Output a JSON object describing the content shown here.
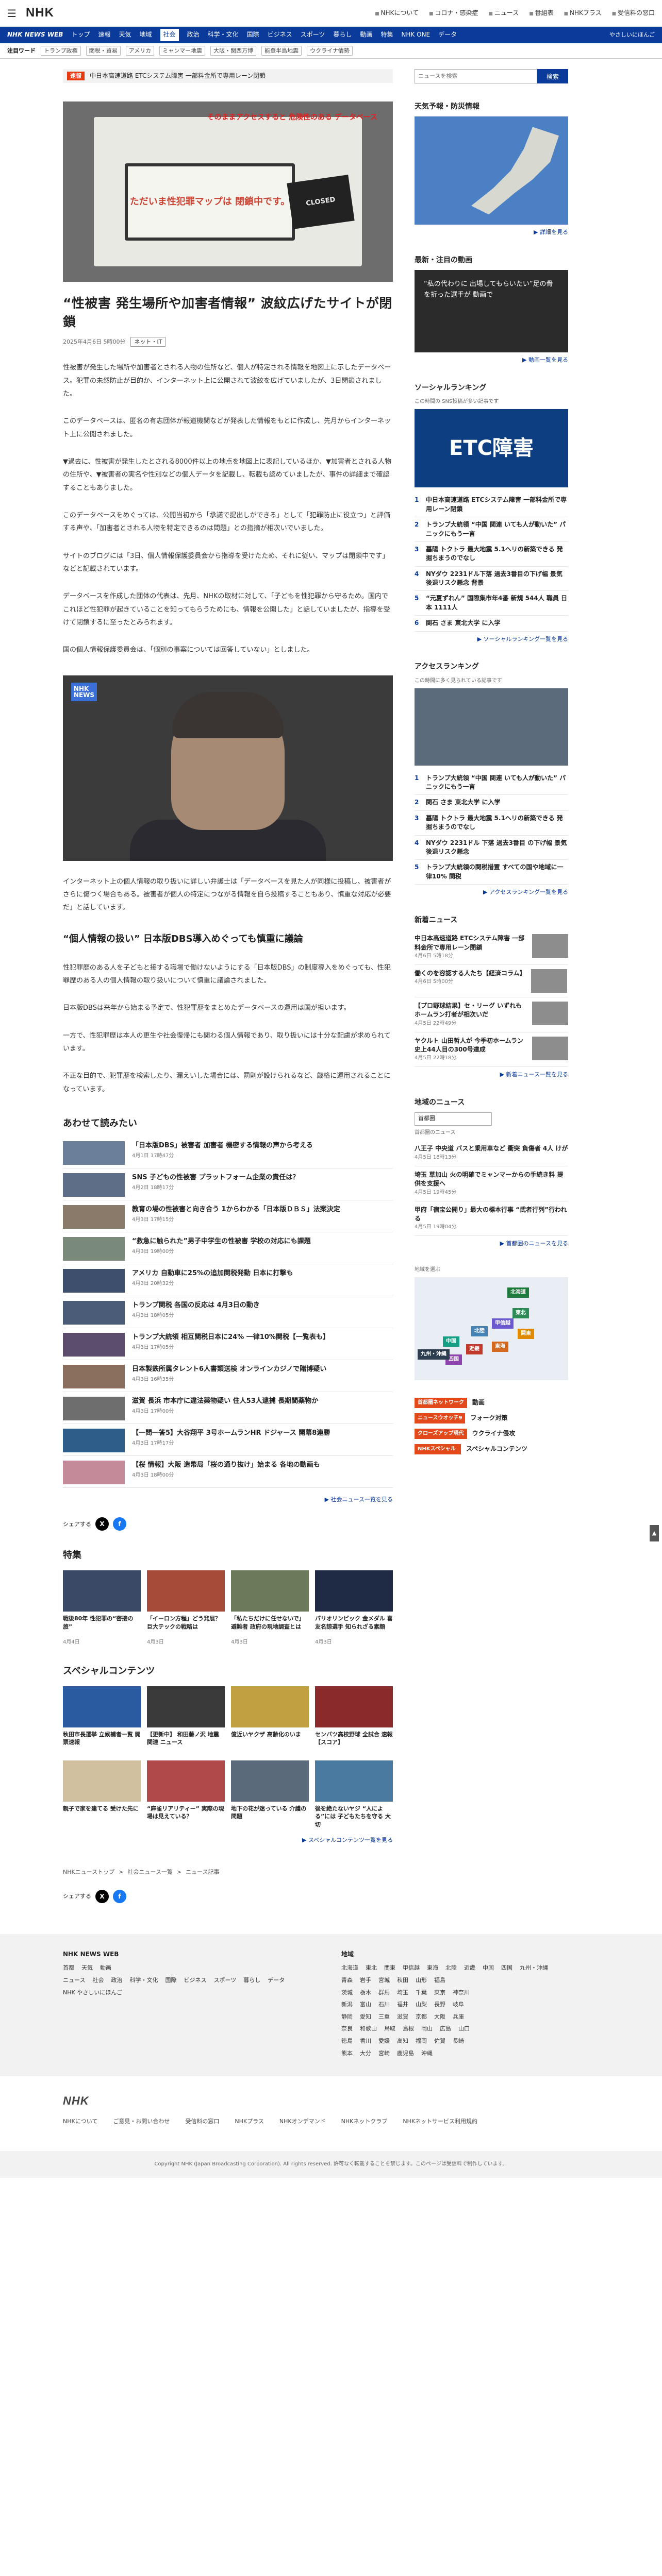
{
  "header": {
    "logo": "NHK",
    "links": [
      "NHKについて",
      "コロナ・感染症",
      "ニュース",
      "番組表",
      "NHKプラス",
      "受信料の窓口"
    ]
  },
  "newsnav": {
    "brand": "NHK NEWS WEB",
    "items": [
      "トップ",
      "速報",
      "天気",
      "地域",
      "社会",
      "政治",
      "科学・文化",
      "国際",
      "ビジネス",
      "国際",
      "スポーツ",
      "暮らし",
      "動画",
      "特集",
      "NHK ONE",
      "データ"
    ],
    "active": "社会",
    "right": "やさしいにほんご"
  },
  "subnav": {
    "label": "注目ワード",
    "tags": [
      "トランプ政権",
      "関税・貿易",
      "アメリカ",
      "ミャンマー地震",
      "大阪・関西万博",
      "能登半島地震",
      "ウクライナ情勢"
    ]
  },
  "ticker": {
    "badge": "速報",
    "text": "中日本高速道路 ETCシステム障害 一部料金所で専用レーン閉鎖"
  },
  "hero": {
    "laptop_text": "ただいま性犯罪マップは 閉鎖中です。",
    "closed_text": "CLOSED",
    "warn": "そのままアクセスすると 危険性のある データベース"
  },
  "article": {
    "title": "“性被害 発生場所や加害者情報” 波紋広げたサイトが閉鎖",
    "date": "2025年4月6日 5時00分",
    "category": "ネット・IT",
    "paragraphs": [
      "性被害が発生した場所や加害者とされる人物の住所など、個人が特定される情報を地図上に示したデータベース。犯罪の未然防止が目的か、インターネット上に公開されて波紋を広げていましたが、3日閉鎖されました。",
      "このデータベースは、匿名の有志団体が報道機関などが発表した情報をもとに作成し、先月からインターネット上に公開されました。",
      "▼過去に、性被害が発生したとされる8000件以上の地点を地図上に表記しているほか、▼加害者とされる人物の住所や、▼被害者の実名や性別などの個人データを記載し、転載も認めていましたが、事件の詳細まで確認することもありました。",
      "このデータベースをめぐっては、公開当初から「承諾で提出しができる」として「犯罪防止に役立つ」と評価する声や、「加害者とされる人物を特定できるのは問題」との指摘が相次いでいました。",
      "サイトのブログには「3日、個人情報保護委員会から指導を受けたため、それに従い、マップは閉鎖中です」などと記載されています。",
      "データベースを作成した団体の代表は、先月、NHKの取材に対して、「子どもを性犯罪から守るため。国内でこれほど性犯罪が起きていることを知ってもらうためにも、情報を公開した」と話していましたが、指導を受けて閉鎖するに至ったとみられます。",
      "国の個人情報保護委員会は、「個別の事案については回答していない」としました。"
    ],
    "caption": "インターネット上の個人情報の取り扱いに詳しい弁護士は「データベースを見た人が同様に投稿し、被害者がさらに傷つく場合もある。被害者が個人の特定につながる情報を自ら投稿することもあり、慎重な対応が必要だ」と話しています。",
    "subhead": "“個人情報の扱い” 日本版DBS導入めぐっても慎重に議論",
    "paragraphs2": [
      "性犯罪歴のある人を子どもと接する職場で働けないようにする「日本版DBS」の制度導入をめぐっても、性犯罪歴のある人の個人情報の取り扱いについて慎重に議論されました。",
      "日本版DBSは来年から始まる予定で、性犯罪歴をまとめたデータベースの運用は国が担います。",
      "一方で、性犯罪歴は本人の更生や社会復帰にも関わる個人情報であり、取り扱いには十分な配慮が求められています。",
      "不正な目的で、犯罪歴を検索したり、漏えいした場合には、罰則が設けられるなど、厳格に運用されることになっています。"
    ]
  },
  "related": {
    "title": "あわせて読みたい",
    "items": [
      {
        "t": "「日本版DBS」被害者 加害者 機密する情報の声から考える",
        "d": "4月1日 17時47分"
      },
      {
        "t": "SNS 子どもの性被害 プラットフォーム企業の責任は？",
        "d": "4月2日 18時17分"
      },
      {
        "t": "教育の場の性被害と向き合う 1からわかる「日本版ＤＢＳ」法案決定",
        "d": "4月3日 17時15分"
      },
      {
        "t": "“救急に触られた”男子中学生の性被害 学校の対応にも課題",
        "d": "4月3日 19時00分"
      },
      {
        "t": "アメリカ 自動車に25%の追加関税発動 日本に打撃も",
        "d": "4月3日 20時32分"
      },
      {
        "t": "トランプ関税 各国の反応は 4月3日の動き",
        "d": "4月3日 18時05分"
      },
      {
        "t": "トランプ大統領 相互関税日本に24% 一律10%関税【一覧表も】",
        "d": "4月3日 17時05分"
      },
      {
        "t": "日本製鉄所属タレント6人書類送検 オンラインカジノで賭博疑い",
        "d": "4月3日 16時35分"
      },
      {
        "t": "滋賀 長浜 市本庁に違法薬物疑い 住人53人逮捕 長期間薬物か",
        "d": "4月3日 17時00分"
      },
      {
        "t": "【一問一答5】大谷翔平 3号ホームランHR ドジャース 開幕8連勝",
        "d": "4月3日 17時17分"
      },
      {
        "t": "【桜 情報】大阪 造幣局「桜の通り抜け」始まる 各地の動画も",
        "d": "4月3日 18時00分"
      }
    ],
    "more": "▶ 社会ニュース一覧を見る"
  },
  "share": {
    "label": "シェアする"
  },
  "features": {
    "title": "特集",
    "items": [
      {
        "t": "戦後80年 性犯罪の“密接の旅”",
        "d": "4月4日"
      },
      {
        "t": "「イーロン方程」どう発展？ 巨大テックの戦略は",
        "d": "4月3日"
      },
      {
        "t": "「私たちだけに任せないで」 避難者 政府の現地調査とは",
        "d": "4月3日"
      },
      {
        "t": "パリオリンピック 金メダル 喜友名諒選手 知られざる素顔",
        "d": "4月3日"
      }
    ]
  },
  "special": {
    "title": "スペシャルコンテンツ",
    "items": [
      {
        "t": "秋田市長選挙 立候補者一覧 開票速報",
        "d": ""
      },
      {
        "t": "【更新中】 和田藤ノ沢 地震 関連 ニュース",
        "d": ""
      },
      {
        "t": "億近いヤクザ 高齢化のいま",
        "d": ""
      },
      {
        "t": "センバツ高校野球 全試合 速報 【スコア】",
        "d": ""
      },
      {
        "t": "親子で家を建てる 受けた先に",
        "d": ""
      },
      {
        "t": "“麻雀リアリティー” 実際の現場は見えている？",
        "d": ""
      },
      {
        "t": "地下の花が迷っている 介護の問題",
        "d": ""
      },
      {
        "t": "後を絶たないヤジ “人による”には 子どもたちを守る 大切",
        "d": ""
      }
    ],
    "more": "▶ スペシャルコンテンツ一覧を見る"
  },
  "breadcrumb": [
    "NHKニューストップ",
    "社会ニュース一覧",
    "ニュース記事"
  ],
  "sidebar": {
    "search_placeholder": "ニュースを検索",
    "search_btn": "検索",
    "weather_title": "天気予報・防災情報",
    "weather_link": "▶ 詳細を見る",
    "video_title": "最新・注目の動画",
    "video_text": "“私の代わりに 出場してもらいたい”足の骨を折った選手が 動画で",
    "video_link": "▶ 動画一覧を見る",
    "social_title": "ソーシャルランキング",
    "social_note": "この時間の SNS投稿が多い記事です",
    "etc_text": "ETC障害",
    "social_rank": [
      "中日本高速道路 ETCシステム障害 一部料金所で専用レーン閉鎖",
      "トランプ大統領 “中国 関連 いても人が動いた” パニックにもう一言",
      "墓陽 トクトラ 最大地震 5.1ヘリの新築できる 発掘ちまうのでなし",
      "NYダウ 2231ドル下落 過去3番目の下げ幅 景気後退リスク懸念 背景",
      "“元夏ずれん” 国際集市年4番 新規 544人 職員 日本 1111人",
      "関石 さま 東北大学 に入学"
    ],
    "social_link": "▶ ソーシャルランキング一覧を見る",
    "access_title": "アクセスランキング",
    "access_note": "この時間に多く見られている記事です",
    "access_rank": [
      "トランプ大統領 “中国 関連 いても人が動いた” パニックにもう一言",
      "関石 さま 東北大学 に入学",
      "墓陽 トクトラ 最大地震 5.1ヘリの新築できる 発掘ちまうのでなし",
      "NYダウ 2231ドル 下落 過去3番目 の下げ幅 景気後退リスク懸念",
      "トランプ大統領の関税措置 すべての国や地域に一律10% 関税"
    ],
    "access_link": "▶ アクセスランキング一覧を見る",
    "new_title": "新着ニュース",
    "new_items": [
      {
        "t": "中日本高速道路 ETCシステム障害 一部料金所で専用レーン閉鎖",
        "d": "4月6日 5時18分"
      },
      {
        "t": "働くのを容認する人たち【経済コラム】",
        "d": "4月6日 5時00分"
      },
      {
        "t": "【プロ野球結果】セ・リーグ いずれも ホームラン打者が相次いだ",
        "d": "4月5日 22時49分"
      },
      {
        "t": "ヤクルト 山田哲人が 今季初ホームラン 史上44人目の300号達成",
        "d": "4月5日 22時18分"
      }
    ],
    "new_link": "▶ 新着ニュース一覧を見る",
    "region_title": "地域のニュース",
    "region_select": "首都圏",
    "region_sub": "首都圏のニュース",
    "region_items": [
      {
        "t": "八王子 中央道 バスと乗用車など 衝突 負傷者 4人 けが",
        "d": "4月5日 18時13分"
      },
      {
        "t": "埼玉 草加山 火の明確でミャンマーからの手続き料 提供を支援へ",
        "d": "4月5日 19時45分"
      },
      {
        "t": "甲府「宿宝公開り」最大の標本行事 “武者行列”行われる",
        "d": "4月5日 19時04分"
      }
    ],
    "region_link": "▶ 首都圏のニュースを見る",
    "map_label": "地域を選ぶ",
    "regions": [
      "北海道",
      "東北",
      "関東",
      "甲信越",
      "東海",
      "北陸",
      "近畿",
      "中国",
      "四国",
      "九州・沖縄"
    ],
    "tags": [
      {
        "b": "首都圏ネットワーク",
        "t": "動画"
      },
      {
        "b": "ニュースウオッチ9",
        "t": "フォーク対策"
      },
      {
        "b": "クローズアップ現代",
        "t": "ウクライナ侵攻"
      },
      {
        "b": "NHKスペシャル",
        "t": "スペシャルコンテンツ"
      }
    ]
  },
  "footer": {
    "col1_title": "NHK NEWS WEB",
    "col1_rows": [
      [
        "首都",
        "天気",
        "動画"
      ],
      [
        "ニュース",
        "社会",
        "政治",
        "科学・文化",
        "国際",
        "ビジネス",
        "スポーツ",
        "暮らし",
        "データ"
      ],
      [
        "NHK やさしいにほんご"
      ]
    ],
    "col2_title": "地域",
    "col2_rows": [
      [
        "北海道",
        "東北",
        "関東",
        "甲信越",
        "東海",
        "北陸",
        "近畿",
        "中国",
        "四国",
        "九州・沖縄"
      ],
      [
        "青森",
        "岩手",
        "宮城",
        "秋田",
        "山形",
        "福島"
      ],
      [
        "茨城",
        "栃木",
        "群馬",
        "埼玉",
        "千葉",
        "東京",
        "神奈川"
      ],
      [
        "新潟",
        "富山",
        "石川",
        "福井",
        "山梨",
        "長野",
        "岐阜"
      ],
      [
        "静岡",
        "愛知",
        "三重",
        "滋賀",
        "京都",
        "大阪",
        "兵庫"
      ],
      [
        "奈良",
        "和歌山",
        "鳥取",
        "島根",
        "岡山",
        "広島",
        "山口"
      ],
      [
        "徳島",
        "香川",
        "愛媛",
        "高知",
        "福岡",
        "佐賀",
        "長崎"
      ],
      [
        "熊本",
        "大分",
        "宮崎",
        "鹿児島",
        "沖縄"
      ]
    ],
    "bottom_links": [
      "NHKについて",
      "ご意見・お問い合わせ",
      "受信料の窓口",
      "NHKプラス",
      "NHKオンデマンド",
      "NHKネットクラブ",
      "NHKネットサービス利用規約"
    ],
    "copyright": "Copyright NHK (Japan Broadcasting Corporation). All rights reserved. 許可なく転載することを禁じます。このページは受信料で制作しています。"
  }
}
